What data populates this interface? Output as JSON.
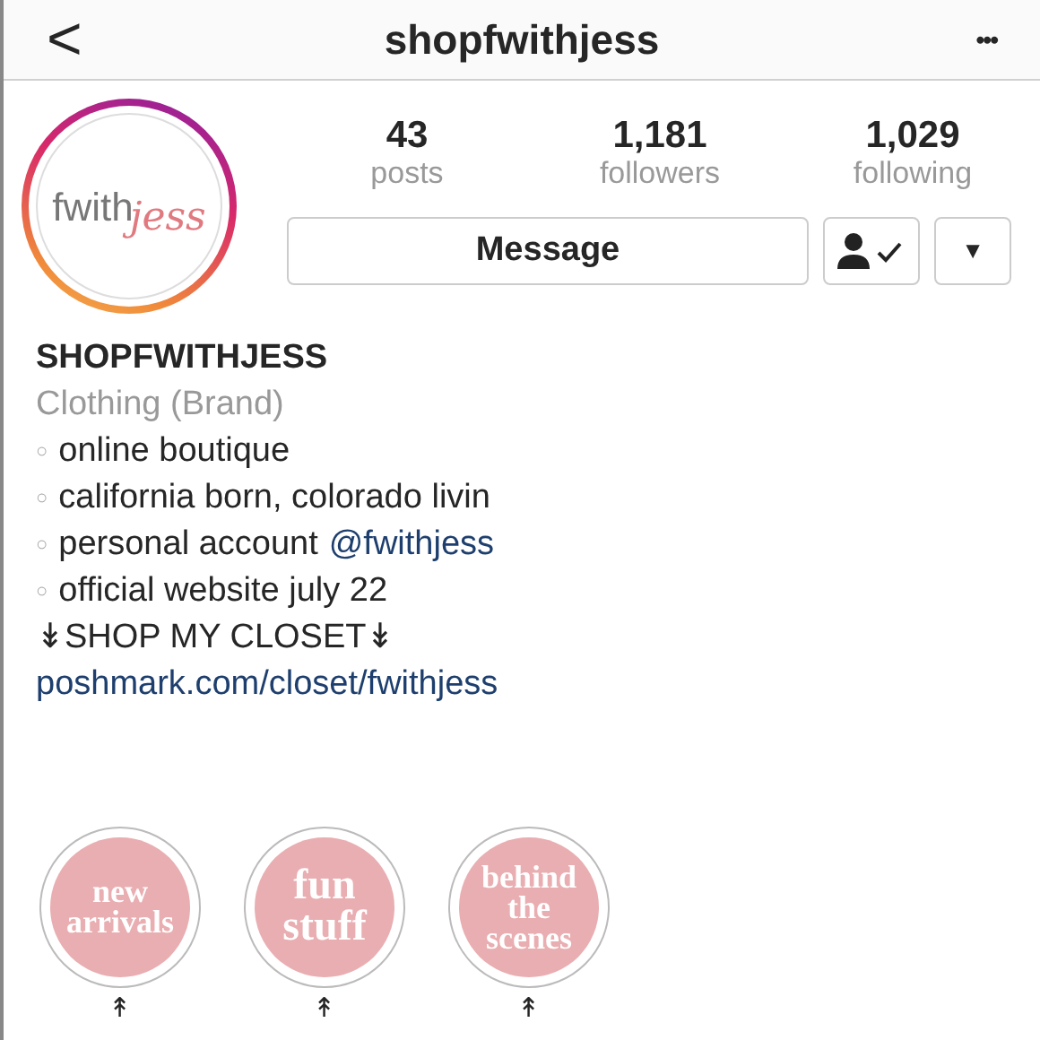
{
  "header": {
    "back": "<",
    "title": "shopfwithjess",
    "more": "•••"
  },
  "profile": {
    "avatar": {
      "logo_left": "fwith",
      "logo_right": "jess"
    },
    "stats": [
      {
        "value": "43",
        "label": "posts"
      },
      {
        "value": "1,181",
        "label": "followers"
      },
      {
        "value": "1,029",
        "label": "following"
      }
    ],
    "buttons": {
      "message": "Message",
      "dropdown": "▼"
    }
  },
  "bio": [
    {
      "kind": "name",
      "parts": [
        {
          "text": "SHOPFWITHJESS",
          "link": false
        }
      ]
    },
    {
      "kind": "category",
      "parts": [
        {
          "text": "Clothing (Brand)",
          "link": false
        }
      ]
    },
    {
      "kind": "bullet",
      "bullet": "○",
      "parts": [
        {
          "text": "online boutique",
          "link": false
        }
      ]
    },
    {
      "kind": "bullet",
      "bullet": "○",
      "parts": [
        {
          "text": "california born, colorado livin",
          "link": false
        }
      ]
    },
    {
      "kind": "bullet",
      "bullet": "○",
      "parts": [
        {
          "text": "personal account",
          "link": false
        },
        {
          "text": "@fwithjess",
          "link": true
        }
      ]
    },
    {
      "kind": "bullet",
      "bullet": "○",
      "parts": [
        {
          "text": "official website july 22",
          "link": false
        }
      ]
    },
    {
      "kind": "plain",
      "parts": [
        {
          "text": "↡SHOP MY CLOSET↡",
          "link": false
        }
      ]
    },
    {
      "kind": "plain",
      "parts": [
        {
          "text": "poshmark.com/closet/fwithjess",
          "link": true
        }
      ]
    }
  ],
  "highlights": [
    {
      "lines": [
        "new",
        "arrivals"
      ],
      "kind": "small",
      "caption": "↟"
    },
    {
      "lines": [
        "fun",
        "stuff"
      ],
      "kind": "large",
      "caption": "↟"
    },
    {
      "lines": [
        "behind",
        "the",
        "scenes"
      ],
      "kind": "small",
      "caption": "↟"
    }
  ]
}
